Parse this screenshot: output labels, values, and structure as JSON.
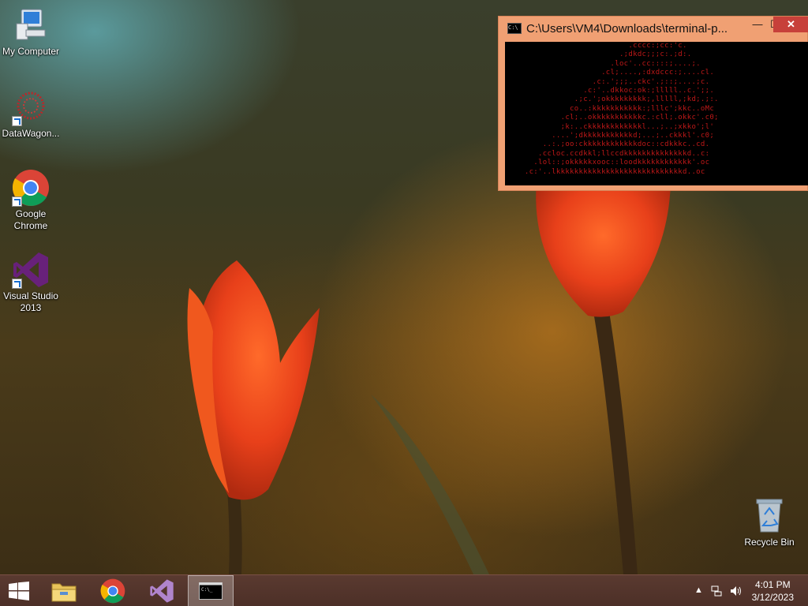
{
  "desktop": {
    "icons": [
      {
        "label": "My Computer",
        "icon": "computer-icon"
      },
      {
        "label": "DataWagon...",
        "icon": "datawagon-icon"
      },
      {
        "label": "Google Chrome",
        "icon": "chrome-icon"
      },
      {
        "label": "Visual Studio 2013",
        "icon": "visual-studio-icon"
      }
    ],
    "recycle_bin": {
      "label": "Recycle Bin",
      "icon": "recycle-bin-icon"
    }
  },
  "console": {
    "title": "C:\\Users\\VM4\\Downloads\\terminal-p...",
    "controls": {
      "minimize": "—",
      "maximize": "☐",
      "close": "✕"
    },
    "ascii_art": "                           .cccc:;cc:'c.\n                         .;dkdc;;;c:.;d:.\n                       .loc'..cc::::;....;.\n                     .cl;....,:dxdccc:;....cl.\n                   .c:.';;;..ckc'.;::;....;c.\n                 .c:'..dkkoc:ok:;lllll..c.';;.\n               .;c.';okkkkkkkkk;,lllll,;kd;.;:.\n              co..:kkkkkkkkkkk:;lllc';kkc..oMc\n            .cl;..okkkkkkkkkkkc.:cll;.okkc'.c0;\n            ;k:..ckkkkkkkkkkkkl...;..;xkko';l'\n          ....';dkkkkkkkkkkkd;...;..ckkkl'.c0;\n        ..:.;oo:ckkkkkkkkkkkkdoc::cdkkkc..cd.\n       .ccloc.ccdkkl;llccdkkkkkkkkkkkkkkd..c:\n      .lol::;okkkkkxooc::loodkkkkkkkkkkkk'.oc\n    .c:'..lkkkkkkkkkkkkkkkkkkkkkkkkkkkkd..oc"
  },
  "taskbar": {
    "start": {
      "icon": "windows-start-icon"
    },
    "pinned": [
      {
        "name": "File Explorer",
        "icon": "file-explorer-icon"
      },
      {
        "name": "Google Chrome",
        "icon": "chrome-icon"
      },
      {
        "name": "Visual Studio",
        "icon": "visual-studio-icon"
      },
      {
        "name": "Command Prompt",
        "icon": "command-prompt-icon",
        "active": true
      }
    ],
    "tray": {
      "icons": [
        "show-hidden-icons-chevron",
        "network-icon",
        "volume-icon"
      ],
      "time": "4:01 PM",
      "date": "3/12/2023"
    }
  },
  "colors": {
    "console_frame": "#f0a073",
    "console_text": "#c01818",
    "taskbar": "#4c2f27",
    "close_button": "#c7403a"
  }
}
